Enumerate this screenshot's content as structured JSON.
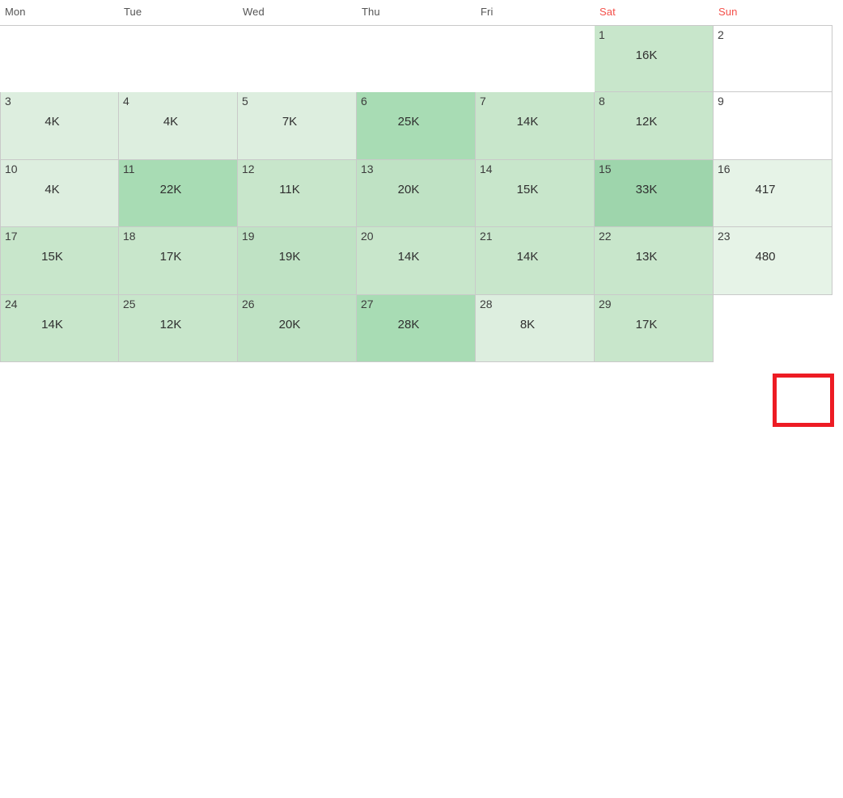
{
  "header": {
    "weekdays": [
      {
        "label": "Mon",
        "weekend": false
      },
      {
        "label": "Tue",
        "weekend": false
      },
      {
        "label": "Wed",
        "weekend": false
      },
      {
        "label": "Thu",
        "weekend": false
      },
      {
        "label": "Fri",
        "weekend": false
      },
      {
        "label": "Sat",
        "weekend": true
      },
      {
        "label": "Sun",
        "weekend": true
      }
    ]
  },
  "colors": {
    "weekend_text": "#f4504a",
    "weekday_text": "#555555",
    "grid_border": "#c9c9c9",
    "heat_lightest": "#e6f3e7",
    "heat_light": "#ddeedf",
    "heat_mid": "#c8e6cb",
    "heat_dark": "#a8dcb4",
    "fab_background": "#18856c",
    "highlight_border": "#ed1c24",
    "cell_empty": "#ffffff"
  },
  "chart_data": {
    "type": "heatmap",
    "title": "",
    "xlabel": "",
    "ylabel": "",
    "categories": [
      "Mon",
      "Tue",
      "Wed",
      "Thu",
      "Fri",
      "Sat",
      "Sun"
    ],
    "value_unit": "K",
    "value_range": [
      417,
      33000
    ],
    "weeks": [
      [
        {
          "day": "",
          "value": "",
          "blank": true
        },
        {
          "day": "",
          "value": "",
          "blank": true
        },
        {
          "day": "",
          "value": "",
          "blank": true
        },
        {
          "day": "",
          "value": "",
          "blank": true
        },
        {
          "day": "",
          "value": "",
          "blank": true
        },
        {
          "day": "1",
          "value": "16K",
          "amount": 16000,
          "shade": "mid"
        },
        {
          "day": "2",
          "value": "",
          "amount": 0,
          "shade": "none"
        }
      ],
      [
        {
          "day": "3",
          "value": "4K",
          "amount": 4000,
          "shade": "light"
        },
        {
          "day": "4",
          "value": "4K",
          "amount": 4000,
          "shade": "light"
        },
        {
          "day": "5",
          "value": "7K",
          "amount": 7000,
          "shade": "light"
        },
        {
          "day": "6",
          "value": "25K",
          "amount": 25000,
          "shade": "dark"
        },
        {
          "day": "7",
          "value": "14K",
          "amount": 14000,
          "shade": "mid"
        },
        {
          "day": "8",
          "value": "12K",
          "amount": 12000,
          "shade": "mid"
        },
        {
          "day": "9",
          "value": "",
          "amount": 0,
          "shade": "none"
        }
      ],
      [
        {
          "day": "10",
          "value": "4K",
          "amount": 4000,
          "shade": "light"
        },
        {
          "day": "11",
          "value": "22K",
          "amount": 22000,
          "shade": "dark"
        },
        {
          "day": "12",
          "value": "11K",
          "amount": 11000,
          "shade": "mid"
        },
        {
          "day": "13",
          "value": "20K",
          "amount": 20000,
          "shade": "mid-dark"
        },
        {
          "day": "14",
          "value": "15K",
          "amount": 15000,
          "shade": "mid"
        },
        {
          "day": "15",
          "value": "33K",
          "amount": 33000,
          "shade": "darkest"
        },
        {
          "day": "16",
          "value": "417",
          "amount": 417,
          "shade": "lightest"
        }
      ],
      [
        {
          "day": "17",
          "value": "15K",
          "amount": 15000,
          "shade": "mid"
        },
        {
          "day": "18",
          "value": "17K",
          "amount": 17000,
          "shade": "mid"
        },
        {
          "day": "19",
          "value": "19K",
          "amount": 19000,
          "shade": "mid-dark"
        },
        {
          "day": "20",
          "value": "14K",
          "amount": 14000,
          "shade": "mid"
        },
        {
          "day": "21",
          "value": "14K",
          "amount": 14000,
          "shade": "mid"
        },
        {
          "day": "22",
          "value": "13K",
          "amount": 13000,
          "shade": "mid"
        },
        {
          "day": "23",
          "value": "480",
          "amount": 480,
          "shade": "lightest"
        }
      ],
      [
        {
          "day": "24",
          "value": "14K",
          "amount": 14000,
          "shade": "mid"
        },
        {
          "day": "25",
          "value": "12K",
          "amount": 12000,
          "shade": "mid"
        },
        {
          "day": "26",
          "value": "20K",
          "amount": 20000,
          "shade": "mid-dark"
        },
        {
          "day": "27",
          "value": "28K",
          "amount": 28000,
          "shade": "dark"
        },
        {
          "day": "28",
          "value": "8K",
          "amount": 8000,
          "shade": "light"
        },
        {
          "day": "29",
          "value": "17K",
          "amount": 17000,
          "shade": "mid"
        },
        {
          "day": "",
          "value": "",
          "blank": true
        }
      ]
    ]
  },
  "fab": {
    "icon": "pencil-edit-icon",
    "label": ""
  }
}
